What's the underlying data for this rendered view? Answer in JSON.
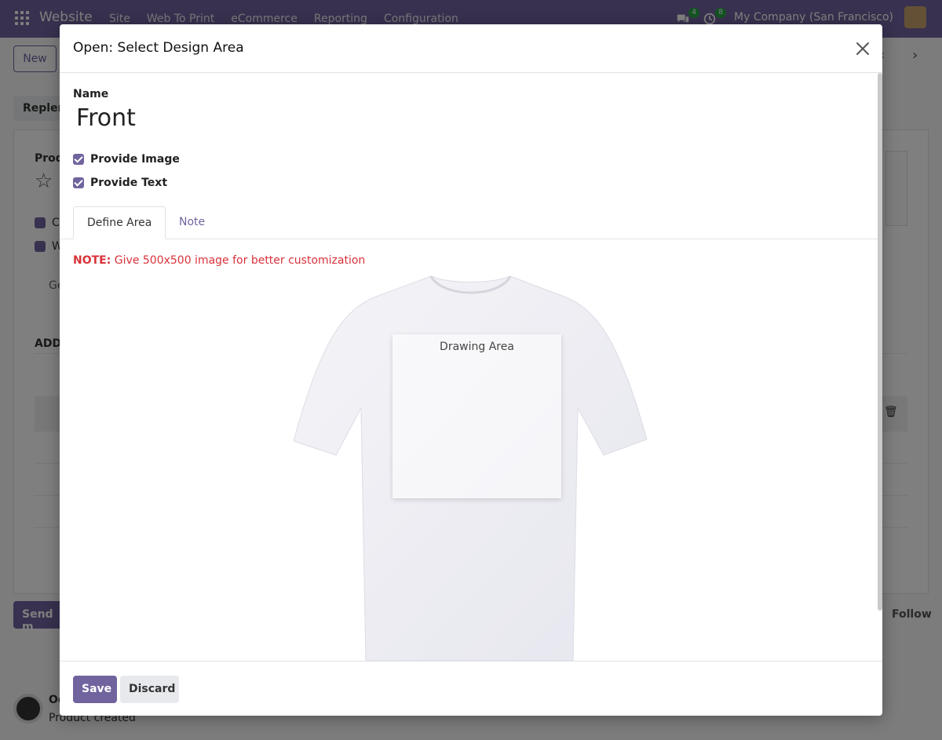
{
  "topbar": {
    "brand": "Website",
    "menu": [
      "Site",
      "Web To Print",
      "eCommerce",
      "Reporting",
      "Configuration"
    ],
    "messages_count": "4",
    "activities_count": "8",
    "company": "My Company (San Francisco)"
  },
  "background": {
    "new_label": "New",
    "tab_label": "Replen",
    "product_label": "Prod",
    "check1": "C",
    "check2": "W",
    "general_tab": "Ge",
    "add_label": "ADD",
    "send_label": "Send m",
    "follow_label": "Follow",
    "chatter_author": "Od",
    "chatter_message": "Product created"
  },
  "modal": {
    "title": "Open: Select Design Area",
    "name_label": "Name",
    "name_value": "Front",
    "provide_image_label": "Provide Image",
    "provide_text_label": "Provide Text",
    "tabs": [
      "Define Area",
      "Note"
    ],
    "note_prefix": "NOTE:",
    "note_text": " Give 500x500 image for better customization",
    "drawing_area_label": "Drawing Area",
    "save_label": "Save",
    "discard_label": "Discard"
  },
  "colors": {
    "primary": "#71639e",
    "danger": "#d9323a"
  }
}
